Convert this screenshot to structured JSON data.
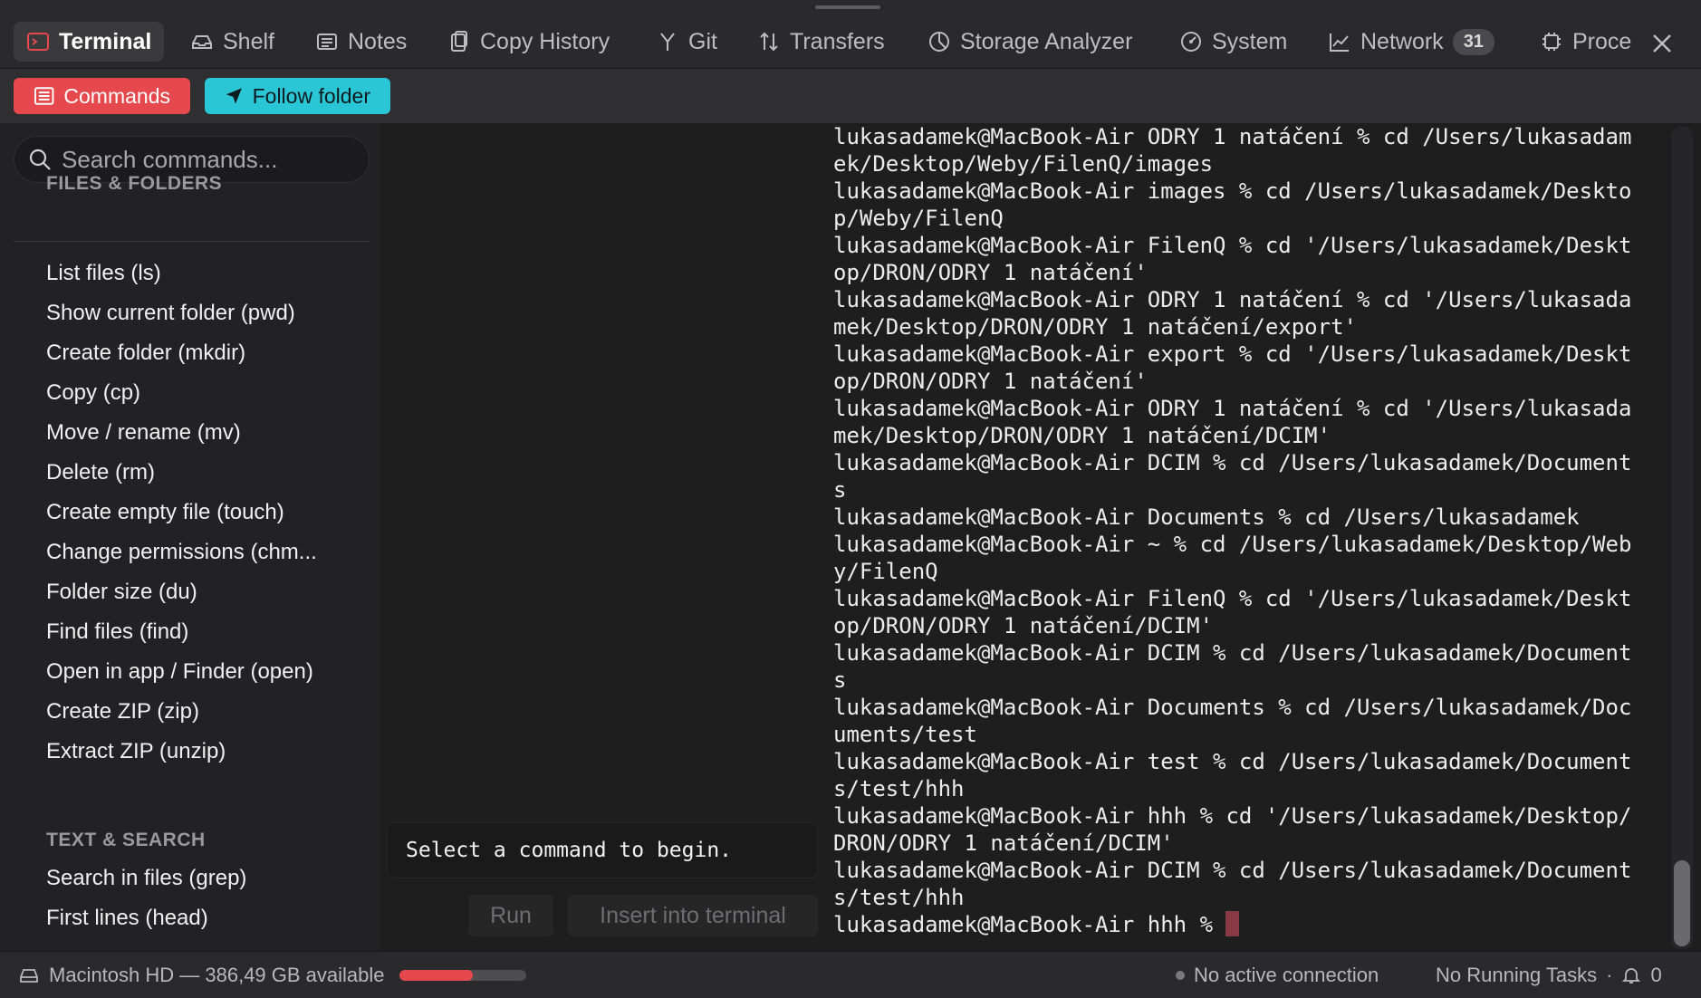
{
  "tabs": [
    {
      "label": "Terminal",
      "icon": "terminal-icon",
      "active": true
    },
    {
      "label": "Shelf",
      "icon": "tray-icon"
    },
    {
      "label": "Notes",
      "icon": "notes-icon"
    },
    {
      "label": "Copy History",
      "icon": "clipboard-icon"
    },
    {
      "label": "Git",
      "icon": "git-branch-icon"
    },
    {
      "label": "Transfers",
      "icon": "transfer-arrows-icon"
    },
    {
      "label": "Storage Analyzer",
      "icon": "pie-chart-icon"
    },
    {
      "label": "System",
      "icon": "gauge-icon"
    },
    {
      "label": "Network",
      "icon": "line-chart-icon",
      "badge": "31"
    },
    {
      "label": "Proce",
      "icon": "cpu-chip-icon"
    }
  ],
  "toolbar": {
    "commands_label": "Commands",
    "follow_label": "Follow folder"
  },
  "sidebar": {
    "search_placeholder": "Search commands...",
    "sections": [
      {
        "title": "FILES & FOLDERS",
        "items": [
          "List files (ls)",
          "Show current folder (pwd)",
          "Create folder (mkdir)",
          "Copy (cp)",
          "Move / rename (mv)",
          "Delete (rm)",
          "Create empty file (touch)",
          "Change permissions (chm...",
          "Folder size (du)",
          "Find files (find)",
          "Open in app / Finder (open)",
          "Create ZIP (zip)",
          "Extract ZIP (unzip)"
        ]
      },
      {
        "title": "TEXT & SEARCH",
        "items": [
          "Search in files (grep)",
          "First lines (head)"
        ]
      }
    ]
  },
  "command_panel": {
    "hint": "Select a command to begin.",
    "run_label": "Run",
    "insert_label": "Insert into terminal"
  },
  "terminal": {
    "lines": [
      "lukasadamek@MacBook-Air ODRY 1 natáčení % cd /Users/lukasadam",
      "ek/Desktop/Weby/FilenQ/images",
      "lukasadamek@MacBook-Air images % cd /Users/lukasadamek/Deskto",
      "p/Weby/FilenQ",
      "lukasadamek@MacBook-Air FilenQ % cd '/Users/lukasadamek/Deskt",
      "op/DRON/ODRY 1 natáčení'",
      "lukasadamek@MacBook-Air ODRY 1 natáčení % cd '/Users/lukasada",
      "mek/Desktop/DRON/ODRY 1 natáčení/export'",
      "lukasadamek@MacBook-Air export % cd '/Users/lukasadamek/Deskt",
      "op/DRON/ODRY 1 natáčení'",
      "lukasadamek@MacBook-Air ODRY 1 natáčení % cd '/Users/lukasada",
      "mek/Desktop/DRON/ODRY 1 natáčení/DCIM'",
      "lukasadamek@MacBook-Air DCIM % cd /Users/lukasadamek/Document",
      "s",
      "lukasadamek@MacBook-Air Documents % cd /Users/lukasadamek",
      "lukasadamek@MacBook-Air ~ % cd /Users/lukasadamek/Desktop/Web",
      "y/FilenQ",
      "lukasadamek@MacBook-Air FilenQ % cd '/Users/lukasadamek/Deskt",
      "op/DRON/ODRY 1 natáčení/DCIM'",
      "lukasadamek@MacBook-Air DCIM % cd /Users/lukasadamek/Document",
      "s",
      "lukasadamek@MacBook-Air Documents % cd /Users/lukasadamek/Doc",
      "uments/test",
      "lukasadamek@MacBook-Air test % cd /Users/lukasadamek/Document",
      "s/test/hhh",
      "lukasadamek@MacBook-Air hhh % cd '/Users/lukasadamek/Desktop/",
      "DRON/ODRY 1 natáčení/DCIM'",
      "lukasadamek@MacBook-Air DCIM % cd /Users/lukasadamek/Document",
      "s/test/hhh"
    ],
    "prompt": "lukasadamek@MacBook-Air hhh % "
  },
  "status": {
    "disk_label": "Macintosh HD — 386,49 GB available",
    "disk_used_fraction": 0.58,
    "connection": "No active connection",
    "tasks": "No Running Tasks",
    "separator": "·",
    "notifications": "0"
  },
  "colors": {
    "accent_red": "#e5484d",
    "accent_cyan": "#2bc6d6",
    "cursor": "#8a3a45"
  }
}
